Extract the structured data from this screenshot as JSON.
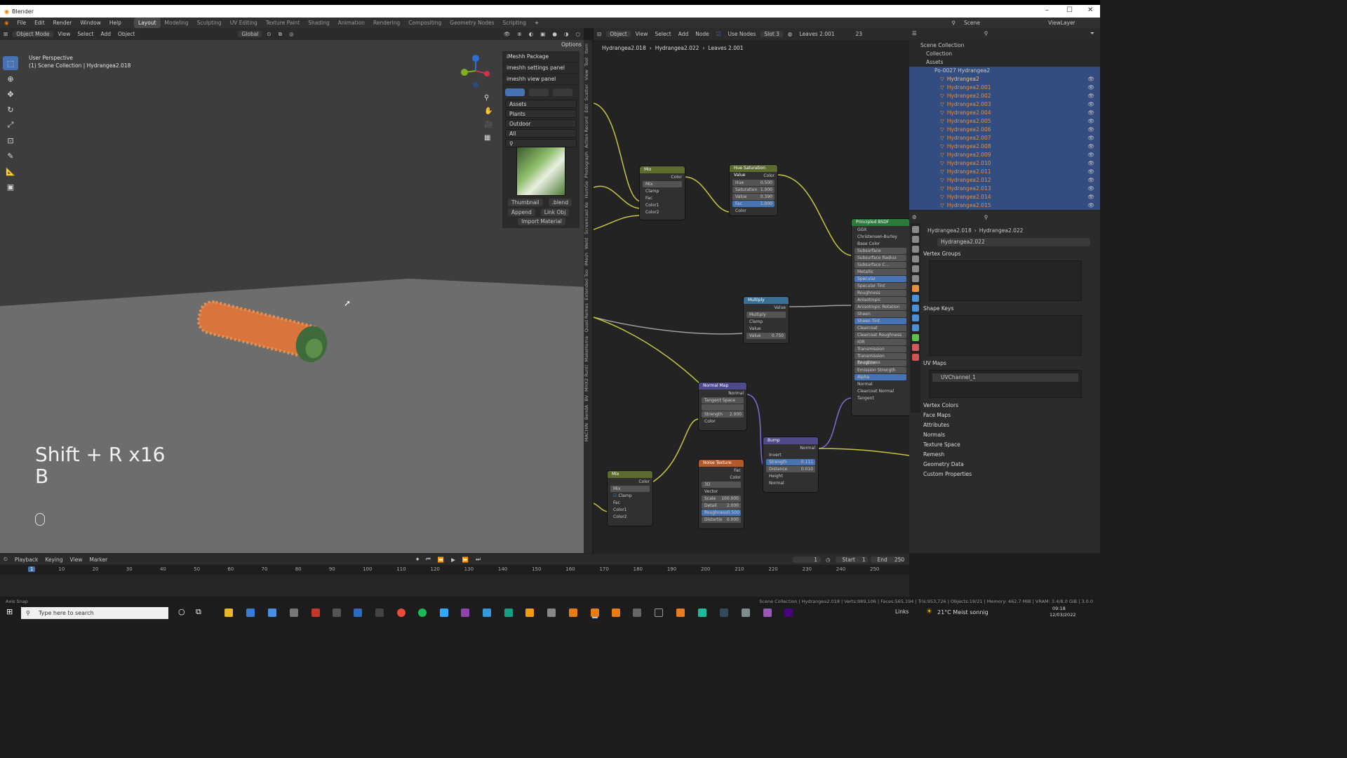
{
  "window": {
    "title": "Blender"
  },
  "menu": {
    "file": "File",
    "edit": "Edit",
    "render": "Render",
    "window": "Window",
    "help": "Help"
  },
  "workspaces": [
    "Layout",
    "Modeling",
    "Sculpting",
    "UV Editing",
    "Texture Paint",
    "Shading",
    "Animation",
    "Rendering",
    "Compositing",
    "Geometry Nodes",
    "Scripting"
  ],
  "topright": {
    "scene": "Scene",
    "viewlayer": "ViewLayer"
  },
  "viewport": {
    "mode": "Object Mode",
    "view": "View",
    "select": "Select",
    "add": "Add",
    "object": "Object",
    "orientation": "Global",
    "options": "Options",
    "perspective": "User Perspective",
    "collection_info": "(1) Scene Collection | Hydrangea2.018",
    "shortcut_line1": "Shift + R x16",
    "shortcut_line2": "B"
  },
  "imesh": {
    "package": "iMeshh Package",
    "settings": "imeshh settings panel",
    "view": "imeshh view panel",
    "sel1": "Assets",
    "sel2": "Plants",
    "sel3": "Outdoor",
    "sel4": "All",
    "thumbnail": "Thumbnail",
    "blend": ".blend",
    "append": "Append",
    "link": "Link Obj",
    "import": "Import Material"
  },
  "vtabs": [
    "Item",
    "Tool",
    "View",
    "Scatter",
    "Edit",
    "Action Record",
    "Photograph",
    "HumGe",
    "Screencast Ke",
    "Weld",
    "iMesh",
    "Extended Too",
    "Quad Remes",
    "MakeHuma",
    "MHX2 Runti",
    "BV",
    "BendA",
    "MACHIN"
  ],
  "nodeeditor": {
    "object": "Object",
    "view": "View",
    "select": "Select",
    "add": "Add",
    "node": "Node",
    "use_nodes": "Use Nodes",
    "slot": "Slot 3",
    "material": "Leaves 2.001",
    "users": "23",
    "crumb1": "Hydrangea2.018",
    "crumb2": "Hydrangea2.022",
    "crumb3": "Leaves 2.001",
    "mix1": {
      "title": "Mix",
      "out": "Color",
      "mode": "Mix",
      "clamp": "Clamp",
      "fac": "Fac",
      "c1": "Color1",
      "c2": "Color2"
    },
    "hsv": {
      "title": "Hue Saturation Value",
      "out": "Color",
      "hue": "Hue",
      "hue_v": "0.500",
      "sat": "Saturation",
      "sat_v": "1.000",
      "val": "Value",
      "val_v": "0.390",
      "fac": "Fac",
      "fac_v": "1.000",
      "color": "Color"
    },
    "mult": {
      "title": "Multiply",
      "out": "Value",
      "mode": "Multiply",
      "clamp": "Clamp",
      "val": "Value",
      "val2": "Value",
      "val2_v": "0.750"
    },
    "normalmap": {
      "title": "Normal Map",
      "out": "Normal",
      "space": "Tangent Space",
      "strength": "Strength",
      "strength_v": "2.000",
      "color": "Color"
    },
    "bump": {
      "title": "Bump",
      "out": "Normal",
      "invert": "Invert",
      "strength": "Strength",
      "strength_v": "0.111",
      "dist": "Distance",
      "dist_v": "0.010",
      "height": "Height",
      "normal": "Normal"
    },
    "noise": {
      "title": "Noise Texture",
      "fac": "Fac",
      "color": "Color",
      "dim": "3D",
      "vector": "Vector",
      "scale": "Scale",
      "scale_v": "100.000",
      "detail": "Detail",
      "detail_v": "2.000",
      "rough": "Roughness",
      "rough_v": "0.500",
      "distort": "Distortio",
      "distort_v": "0.000"
    },
    "mix2": {
      "title": "Mix",
      "out": "Color",
      "mode": "Mix",
      "clamp": "Clamp",
      "fac": "Fac",
      "c1": "Color1",
      "c2": "Color2"
    },
    "bsdf": {
      "title": "Principled BSDF",
      "rows": [
        "GGX",
        "Christensen-Burley",
        "Base Color",
        "Subsurface",
        "Subsurface Radius",
        "Subsurface C...",
        "Metallic",
        "Specular",
        "Specular Tint",
        "Roughness",
        "Anisotropic",
        "Anisotropic Rotation",
        "Sheen",
        "Sheen Tint",
        "Clearcoat",
        "Clearcoat Roughness",
        "IOR",
        "Transmission",
        "Transmission Roughness",
        "Emission",
        "Emission Strength",
        "Alpha",
        "Normal",
        "Clearcoat Normal",
        "Tangent"
      ]
    }
  },
  "outliner": {
    "root": "Scene Collection",
    "collection": "Collection",
    "assets": "Assets",
    "group": "Po-0027 Hydrangea2",
    "items": [
      "Hydrangea2",
      "Hydrangea2.001",
      "Hydrangea2.002",
      "Hydrangea2.003",
      "Hydrangea2.004",
      "Hydrangea2.005",
      "Hydrangea2.006",
      "Hydrangea2.007",
      "Hydrangea2.008",
      "Hydrangea2.009",
      "Hydrangea2.010",
      "Hydrangea2.011",
      "Hydrangea2.012",
      "Hydrangea2.013",
      "Hydrangea2.014",
      "Hydrangea2.015"
    ]
  },
  "properties": {
    "crumb1": "Hydrangea2.018",
    "crumb2": "Hydrangea2.022",
    "mesh": "Hydrangea2.022",
    "vertex_groups": "Vertex Groups",
    "shape_keys": "Shape Keys",
    "uv_maps": "UV Maps",
    "uv_channel": "UVChannel_1",
    "sections": [
      "Vertex Colors",
      "Face Maps",
      "Attributes",
      "Normals",
      "Texture Space",
      "Remesh",
      "Geometry Data",
      "Custom Properties"
    ]
  },
  "timeline": {
    "playback": "Playback",
    "keying": "Keying",
    "view": "View",
    "marker": "Marker",
    "frame": "1",
    "start_label": "Start",
    "start": "1",
    "end_label": "End",
    "end": "250",
    "ticks": [
      "1",
      "10",
      "20",
      "30",
      "40",
      "50",
      "60",
      "70",
      "80",
      "90",
      "100",
      "110",
      "120",
      "130",
      "140",
      "150",
      "160",
      "170",
      "180",
      "190",
      "200",
      "210",
      "220",
      "230",
      "240",
      "250"
    ]
  },
  "status": {
    "left": "Axis Snap",
    "right": "Scene Collection | Hydrangea2.018 | Verts:989,106 | Faces:565,194 | Tris:953,726 | Objects:19/21 | Memory: 462.7 MiB | VRAM: 3.4/8.0 GiB | 3.0.0"
  },
  "taskbar": {
    "search": "Type here to search",
    "links": "Links",
    "weather": "21°C  Meist sonnig",
    "time": "09:18",
    "date": "12/03/2022"
  },
  "colors": {
    "accent": "#4772b3",
    "selected_row": "#334d80",
    "orange_text": "#e8903b",
    "node_green": "#5e6b2e",
    "node_blue": "#3b6f93",
    "node_purple": "#4f4a8c",
    "node_orange": "#b35a2a",
    "node_bsdf": "#2d7a3c"
  }
}
